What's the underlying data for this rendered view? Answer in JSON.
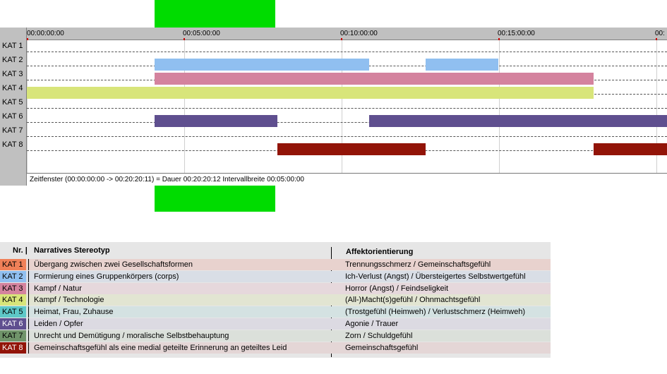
{
  "ruler": {
    "ticks": [
      "00:00:00:00",
      "00:05:00:00",
      "00:10:00:00",
      "00:15:00:00",
      "00:"
    ]
  },
  "categories": [
    "KAT 1",
    "KAT 2",
    "KAT 3",
    "KAT 4",
    "KAT 5",
    "KAT 6",
    "KAT 7",
    "KAT 8"
  ],
  "segments": {
    "KAT 2": [
      [
        "00:04:03",
        "00:10:53"
      ],
      [
        "00:12:40",
        "00:14:58"
      ]
    ],
    "KAT 3": [
      [
        "00:04:03",
        "00:18:00"
      ]
    ],
    "KAT 4": [
      [
        "00:00:00",
        "00:18:00"
      ]
    ],
    "KAT 6": [
      [
        "00:04:03",
        "00:07:57"
      ],
      [
        "00:10:53",
        "00:20:20"
      ]
    ],
    "KAT 8": [
      [
        "00:07:57",
        "00:12:40"
      ],
      [
        "00:18:00",
        "00:20:20"
      ]
    ]
  },
  "colors": {
    "KAT 1": "#f08058",
    "KAT 2": "#90bff0",
    "KAT 3": "#d4839e",
    "KAT 4": "#d8e57a",
    "KAT 5": "#5ec8c8",
    "KAT 6": "#5f4f8f",
    "KAT 7": "#70946a",
    "KAT 8": "#921408",
    "highlight": "#00dc00"
  },
  "status": {
    "text": "Zeitfenster (00:00:00:00 -> 00:20:20:11) = Dauer 00:20:20:12     Intervallbreite 00:05:00:00"
  },
  "legend": {
    "header_nr": "Nr. |",
    "header_name": "Narratives Stereotyp",
    "header_aff": "Affektorientierung",
    "rows": [
      {
        "nr": "KAT 1",
        "name": "Übergang zwischen zwei Gesellschaftsformen",
        "aff": "Trennungsschmerz / Gemeinschaftsgefühl",
        "bg": "#e8d2ce"
      },
      {
        "nr": "KAT 2",
        "name": "Formierung eines Gruppenkörpers (corps)",
        "aff": "Ich-Verlust (Angst) / Übersteigertes Selbstwertgefühl",
        "bg": "#d9dee6"
      },
      {
        "nr": "KAT 3",
        "name": "Kampf / Natur",
        "aff": "Horror (Angst) / Feindseligkeit",
        "bg": "#e6d8dc"
      },
      {
        "nr": "KAT 4",
        "name": "Kampf / Technologie",
        "aff": "(All-)Macht(s)gefühl / Ohnmachtsgefühl",
        "bg": "#e2e5d2"
      },
      {
        "nr": "KAT 5",
        "name": "Heimat, Frau, Zuhause",
        "aff": "(Trostgefühl (Heimweh) / Verlustschmerz (Heimweh)",
        "bg": "#d4e2e2"
      },
      {
        "nr": "KAT 6",
        "name": "Leiden / Opfer",
        "aff": "Agonie / Trauer",
        "bg": "#dcdae2"
      },
      {
        "nr": "KAT 7",
        "name": "Unrecht und Demütigung / moralische Selbstbehauptung",
        "aff": "Zorn / Schuldgefühl",
        "bg": "#dbe0da"
      },
      {
        "nr": "KAT 8",
        "name": "Gemeinschaftsgefühl als eine medial geteilte Erinnerung an geteiltes Leid",
        "aff": "Gemeinschaftsgefühl",
        "bg": "#e4d6d6"
      }
    ]
  }
}
